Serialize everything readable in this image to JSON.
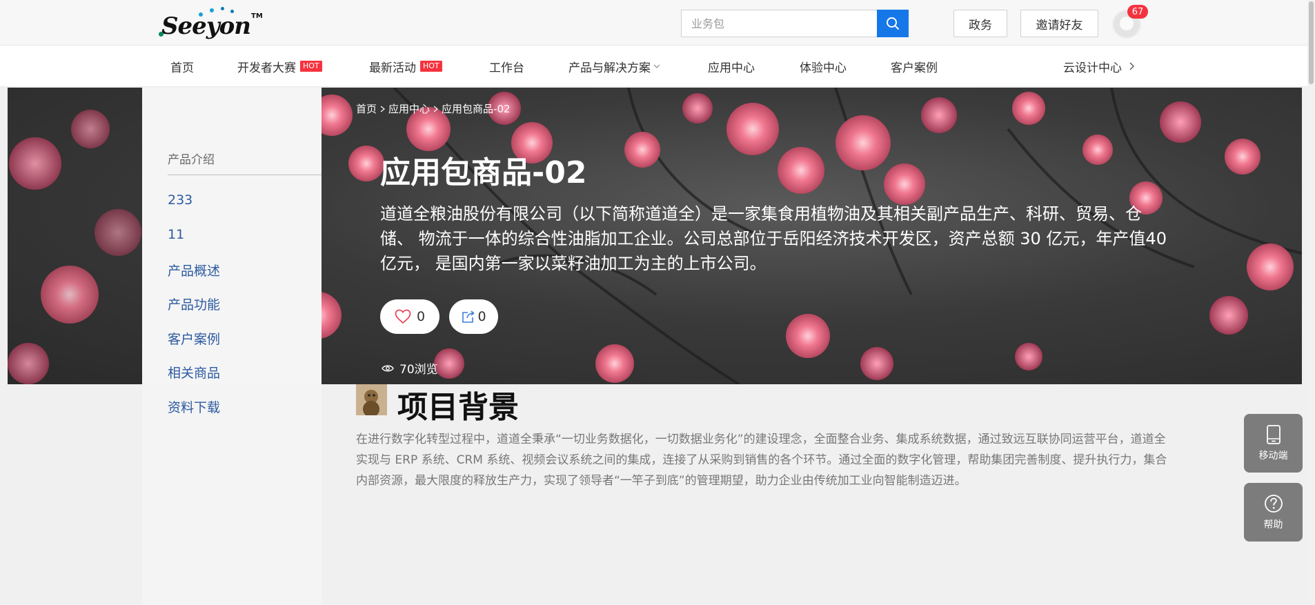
{
  "header": {
    "logo_text": "Seeyon",
    "logo_tm": "TM",
    "search": {
      "placeholder": "业务包",
      "value": ""
    },
    "gov_label": "政务",
    "invite_label": "邀请好友",
    "notification_count": "67"
  },
  "nav": {
    "items": [
      {
        "label": "首页"
      },
      {
        "label": "开发者大赛",
        "badge": "HOT"
      },
      {
        "label": "最新活动",
        "badge": "HOT"
      },
      {
        "label": "工作台"
      },
      {
        "label": "产品与解决方案"
      },
      {
        "label": "应用中心"
      },
      {
        "label": "体验中心"
      },
      {
        "label": "客户案例"
      }
    ],
    "right_link": "云设计中心"
  },
  "breadcrumb": [
    "首页",
    "应用中心",
    "应用包商品-02"
  ],
  "sidebar": {
    "title": "产品介绍",
    "items": [
      {
        "label": "233"
      },
      {
        "label": "11"
      },
      {
        "label": "产品概述"
      },
      {
        "label": "产品功能"
      },
      {
        "label": "客户案例"
      },
      {
        "label": "相关商品"
      },
      {
        "label": "资料下载"
      }
    ]
  },
  "product": {
    "title": "应用包商品-02",
    "description": "道道全粮油股份有限公司（以下简称道道全）是一家集食用植物油及其相关副产品生产、科研、贸易、仓储、 物流于一体的综合性油脂加工企业。公司总部位于岳阳经济技术开发区，资产总额 30 亿元，年产值40亿元， 是国内第一家以菜籽油加工为主的上市公司。",
    "likes": "0",
    "shares": "0",
    "views": "70浏览"
  },
  "section": {
    "title": "项目背景",
    "text": "在进行数字化转型过程中，道道全秉承“一切业务数据化，一切数据业务化”的建设理念，全面整合业务、集成系统数据，通过致远互联协同运营平台，道道全实现与 ERP 系统、CRM 系统、视频会议系统之间的集成，连接了从采购到销售的各个环节。通过全面的数字化管理，帮助集团完善制度、提升执行力，集合内部资源，最大限度的释放生产力，实现了领导者“一竿子到底”的管理期望，助力企业由传统加工业向智能制造迈进。"
  },
  "float": {
    "mobile_label": "移动端",
    "help_label": "帮助"
  },
  "colors": {
    "accent": "#1677e8",
    "hot": "#f5333f",
    "sidebar_link": "#2c5aa0",
    "float_bg": "#7c7c7c"
  },
  "icons": {
    "search": "search-icon",
    "like": "heart-icon",
    "share": "share-icon",
    "views": "eye-icon",
    "mobile": "tablet-icon",
    "help": "question-icon"
  }
}
